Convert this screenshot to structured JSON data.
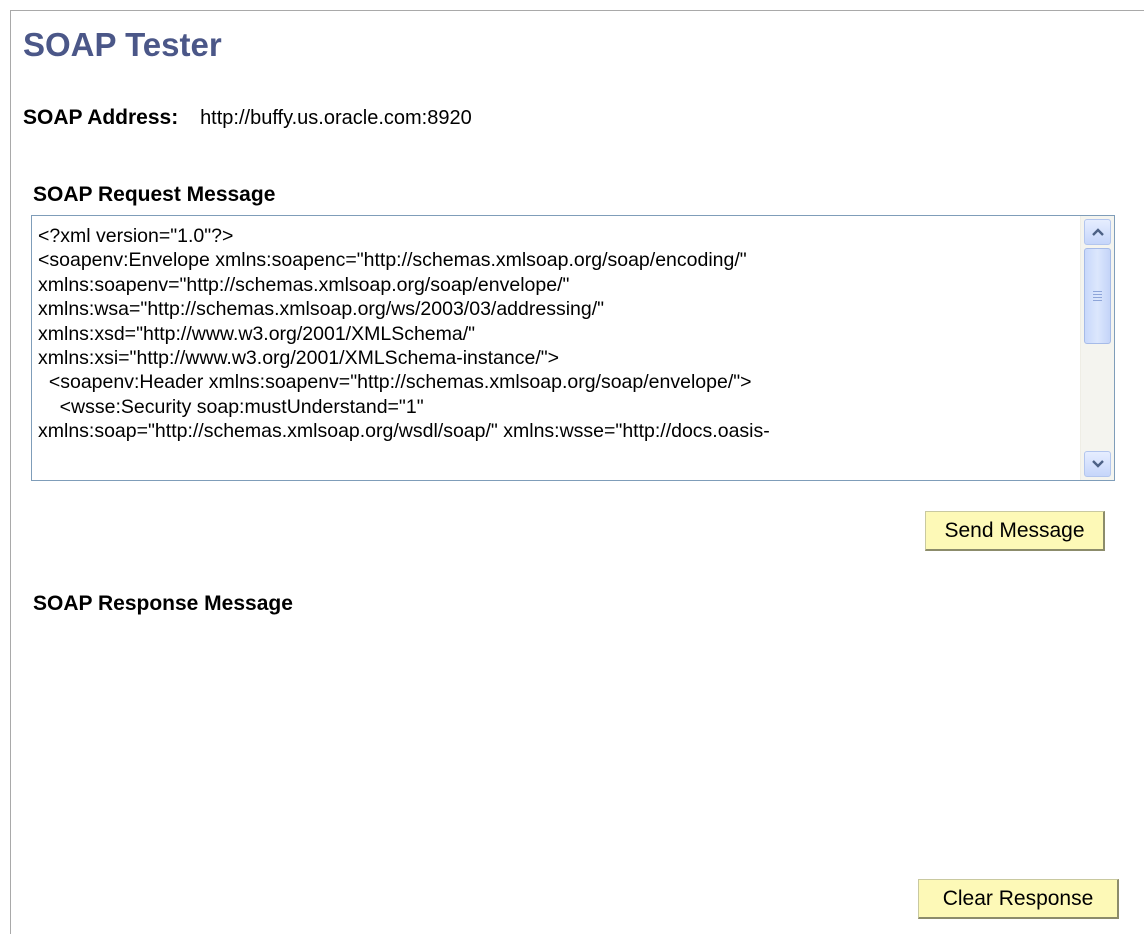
{
  "page": {
    "title": "SOAP Tester"
  },
  "address": {
    "label": "SOAP Address:",
    "value": "http://buffy.us.oracle.com:8920"
  },
  "request": {
    "label": "SOAP Request Message",
    "lines": [
      "<?xml version=\"1.0\"?>",
      "<soapenv:Envelope xmlns:soapenc=\"http://schemas.xmlsoap.org/soap/encoding/\"",
      "xmlns:soapenv=\"http://schemas.xmlsoap.org/soap/envelope/\"",
      "xmlns:wsa=\"http://schemas.xmlsoap.org/ws/2003/03/addressing/\"",
      "xmlns:xsd=\"http://www.w3.org/2001/XMLSchema/\"",
      "xmlns:xsi=\"http://www.w3.org/2001/XMLSchema-instance/\">",
      "  <soapenv:Header xmlns:soapenv=\"http://schemas.xmlsoap.org/soap/envelope/\">",
      "    <wsse:Security soap:mustUnderstand=\"1\"",
      "xmlns:soap=\"http://schemas.xmlsoap.org/wsdl/soap/\" xmlns:wsse=\"http://docs.oasis-"
    ]
  },
  "send_button": {
    "label": "Send Message"
  },
  "response": {
    "label": "SOAP Response Message",
    "body": ""
  },
  "clear_button": {
    "label": "Clear Response"
  },
  "icons": {
    "scroll_up": "chevron-up-icon",
    "scroll_down": "chevron-down-icon"
  },
  "colors": {
    "title": "#4b5788",
    "button_bg": "#fdf9b7",
    "textarea_border": "#7f9db9"
  }
}
